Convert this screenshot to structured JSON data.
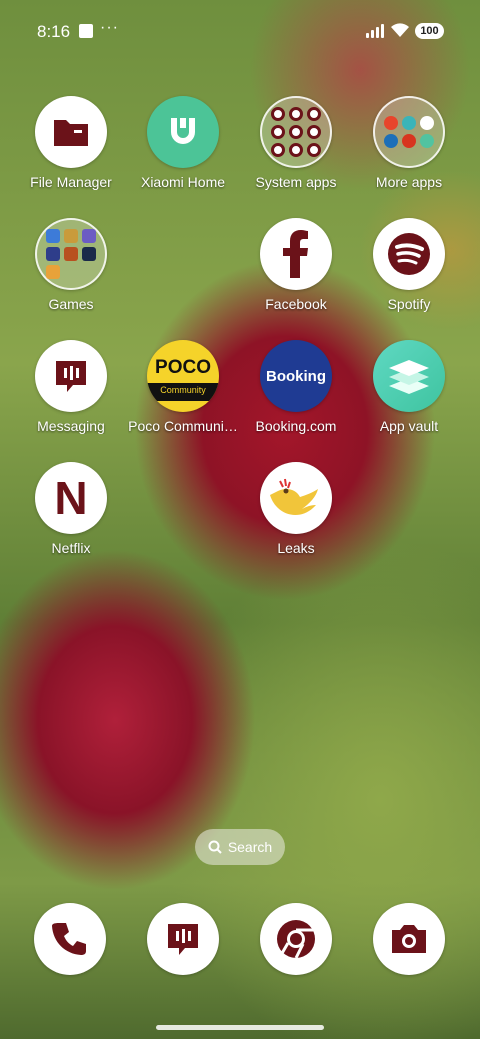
{
  "status": {
    "time": "8:16",
    "battery": "100"
  },
  "apps": [
    {
      "label": "File Manager"
    },
    {
      "label": "Xiaomi Home"
    },
    {
      "label": "System apps"
    },
    {
      "label": "More apps"
    },
    {
      "label": "Games"
    },
    {
      "label": "Facebook"
    },
    {
      "label": "Spotify"
    },
    {
      "label": "Messaging"
    },
    {
      "label": "Poco Communi…",
      "logo_text": "POCO",
      "logo_sub": "Community"
    },
    {
      "label": "Booking.com",
      "logo_text": "Booking"
    },
    {
      "label": "App vault"
    },
    {
      "label": "Netflix",
      "logo_text": "N"
    },
    {
      "label": "Leaks"
    }
  ],
  "search": {
    "label": "Search"
  },
  "colors": {
    "accent": "#6b1219",
    "xiaomi_green": "#4cc497",
    "booking_blue": "#1f3b93",
    "poco_yellow": "#f5d32a"
  },
  "icons": [
    "folder-icon",
    "xiaomi-home-icon",
    "system-apps-folder-icon",
    "more-apps-folder-icon",
    "games-folder-icon",
    "facebook-icon",
    "spotify-icon",
    "messaging-icon",
    "poco-icon",
    "booking-icon",
    "app-vault-icon",
    "netflix-icon",
    "leaks-icon",
    "phone-icon",
    "chrome-icon",
    "camera-icon",
    "search-icon"
  ]
}
